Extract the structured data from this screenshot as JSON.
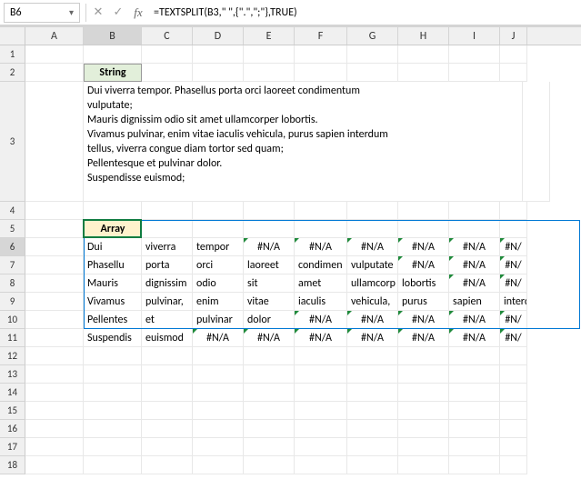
{
  "nameBox": "B6",
  "formula": "=TEXTSPLIT(B3,\" \",{\".\",\";\"},TRUE)",
  "columns": [
    "A",
    "B",
    "C",
    "D",
    "E",
    "F",
    "G",
    "H",
    "I",
    "J"
  ],
  "rowNums": [
    "1",
    "2",
    "3",
    "4",
    "5",
    "6",
    "7",
    "8",
    "9",
    "10",
    "11",
    "12",
    "13",
    "14",
    "15",
    "16",
    "17",
    "18"
  ],
  "headers": {
    "string": "String",
    "array": "Array"
  },
  "b3text": "Dui viverra tempor. Phasellus porta orci laoreet condimentum vulputate;\nMauris dignissim odio sit amet ullamcorper lobortis.\nVivamus pulvinar, enim vitae iaculis vehicula, purus sapien interdum tellus, viverra congue diam tortor sed quam;\nPellentesque et pulvinar dolor.\nSuspendisse euismod;",
  "na": "#N/A",
  "array": {
    "r6": [
      "Dui",
      "viverra",
      "tempor",
      "#N/A",
      "#N/A",
      "#N/A",
      "#N/A",
      "#N/A",
      "#N/"
    ],
    "r7": [
      "Phasellu",
      "porta",
      "orci",
      "laoreet",
      "condimen",
      "vulputate",
      "#N/A",
      "#N/A",
      "#N/"
    ],
    "r8": [
      "Mauris",
      "dignissim",
      "odio",
      "sit",
      "amet",
      "ullamcorp",
      "lobortis",
      "#N/A",
      "#N/"
    ],
    "r9": [
      "Vivamus",
      "pulvinar,",
      "enim",
      "vitae",
      "iaculis",
      "vehicula,",
      "purus",
      "sapien",
      "interd"
    ],
    "r10": [
      "Pellentes",
      "et",
      "pulvinar",
      "dolor",
      "#N/A",
      "#N/A",
      "#N/A",
      "#N/A",
      "#N/"
    ],
    "r11": [
      "Suspendis",
      "euismod",
      "#N/A",
      "#N/A",
      "#N/A",
      "#N/A",
      "#N/A",
      "#N/A",
      "#N/"
    ]
  }
}
